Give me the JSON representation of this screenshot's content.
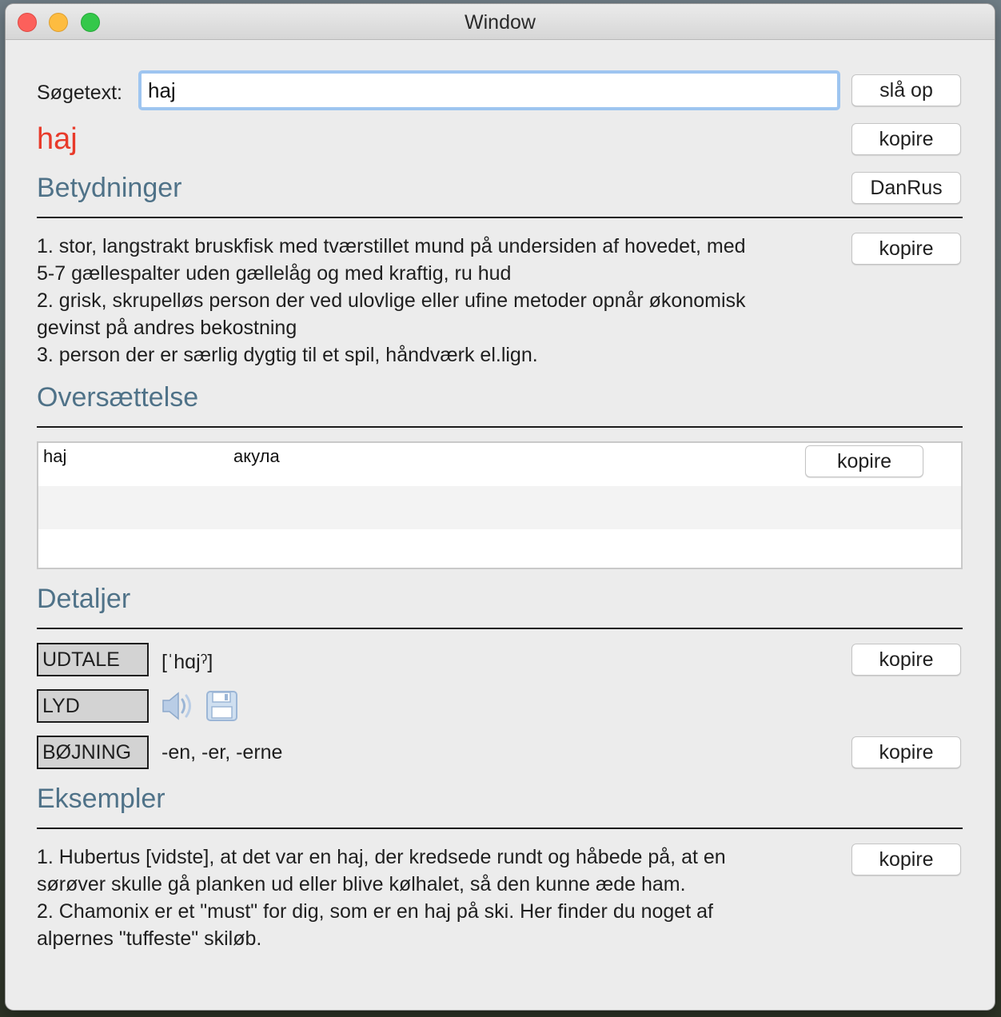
{
  "window": {
    "title": "Window"
  },
  "search": {
    "label": "Søgetext:",
    "value": "haj",
    "button": "slå op"
  },
  "headword": {
    "text": "haj",
    "copy_label": "kopire",
    "color": "#e83a2a"
  },
  "betydninger": {
    "title": "Betydninger",
    "source_button": "DanRus",
    "copy_label": "kopire",
    "lines": [
      "1. stor, langstrakt bruskfisk med tværstillet mund på undersiden af hovedet, med",
      "5-7 gællespalter uden gællelåg og med kraftig, ru hud",
      "2. grisk, skrupelløs person der ved ulovlige eller ufine metoder opnår økonomisk",
      "gevinst på andres bekostning",
      "3. person der er særlig dygtig til et spil, håndværk el.lign."
    ]
  },
  "oversaettelse": {
    "title": "Oversættelse",
    "rows": [
      {
        "source": "haj",
        "target": "акула",
        "copy_label": "kopire"
      }
    ]
  },
  "detaljer": {
    "title": "Detaljer",
    "udtale": {
      "tag": "UDTALE",
      "value": "[ˈhɑjˀ]",
      "copy_label": "kopire"
    },
    "lyd": {
      "tag": "LYD",
      "icons": [
        "speaker-icon",
        "save-icon"
      ]
    },
    "bojning": {
      "tag": "BØJNING",
      "value": "-en, -er, -erne",
      "copy_label": "kopire"
    }
  },
  "eksempler": {
    "title": "Eksempler",
    "copy_label": "kopire",
    "lines": [
      "1. Hubertus [vidste], at det var en haj, der kredsede rundt og håbede på, at en",
      "sørøver skulle gå planken ud eller blive kølhalet, så den kunne æde ham.",
      "2. Chamonix er et \"must\" for dig, som er en haj på ski. Her finder du noget af",
      "alpernes \"tuffeste\" skiløb."
    ]
  },
  "colors": {
    "accent_title": "#4f7288",
    "focus_ring": "#9ec5f0"
  }
}
